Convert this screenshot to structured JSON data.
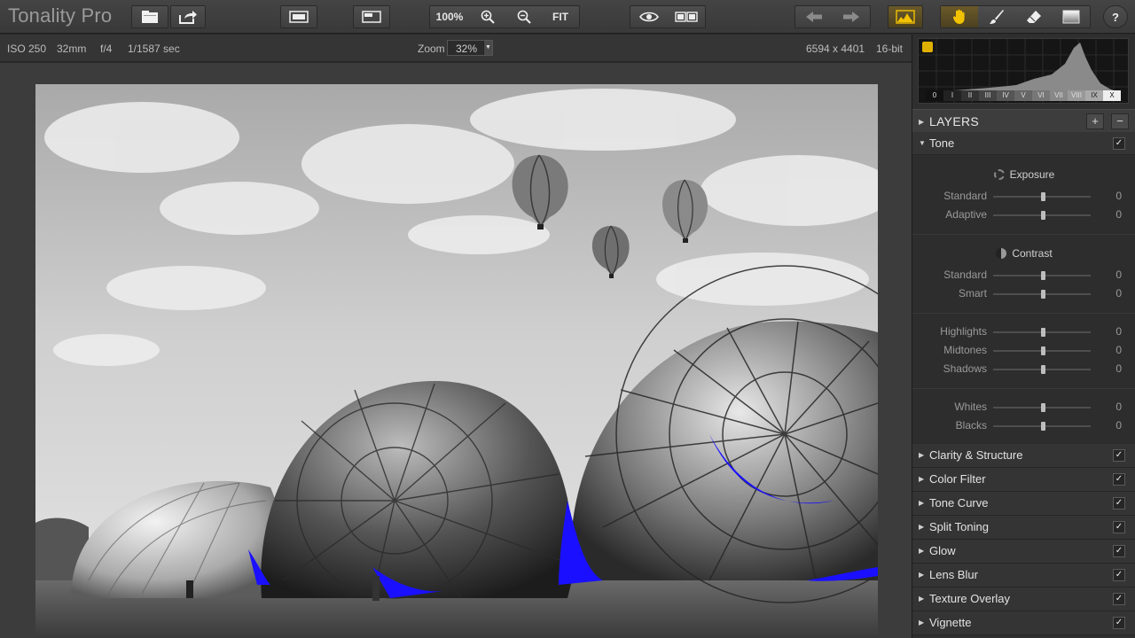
{
  "app": {
    "title": "Tonality Pro"
  },
  "toolbar": {
    "zoom_100": "100%",
    "fit": "FIT"
  },
  "info": {
    "iso": "ISO 250",
    "focal": "32mm",
    "aperture": "f/4",
    "shutter": "1/1587 sec",
    "zoom_label": "Zoom",
    "zoom_value": "32%",
    "dimensions": "6594 x 4401",
    "bitdepth": "16-bit"
  },
  "histogram": {
    "zones": [
      "0",
      "I",
      "II",
      "III",
      "IV",
      "V",
      "VI",
      "VII",
      "VIII",
      "IX",
      "X"
    ]
  },
  "panel": {
    "layers_label": "LAYERS",
    "add": "+",
    "remove": "−",
    "tone": {
      "label": "Tone",
      "exposure_title": "Exposure",
      "contrast_title": "Contrast",
      "sliders": [
        {
          "label": "Standard",
          "value": "0"
        },
        {
          "label": "Adaptive",
          "value": "0"
        },
        {
          "label": "Standard",
          "value": "0"
        },
        {
          "label": "Smart",
          "value": "0"
        },
        {
          "label": "Highlights",
          "value": "0"
        },
        {
          "label": "Midtones",
          "value": "0"
        },
        {
          "label": "Shadows",
          "value": "0"
        },
        {
          "label": "Whites",
          "value": "0"
        },
        {
          "label": "Blacks",
          "value": "0"
        }
      ]
    },
    "sections": [
      {
        "label": "Clarity & Structure"
      },
      {
        "label": "Color Filter"
      },
      {
        "label": "Tone Curve"
      },
      {
        "label": "Split Toning"
      },
      {
        "label": "Glow"
      },
      {
        "label": "Lens Blur"
      },
      {
        "label": "Texture Overlay"
      },
      {
        "label": "Vignette"
      }
    ],
    "check": "✓"
  },
  "colors": {
    "accent_active": "#e0b000",
    "clip_overlay": "#1a10ff"
  }
}
